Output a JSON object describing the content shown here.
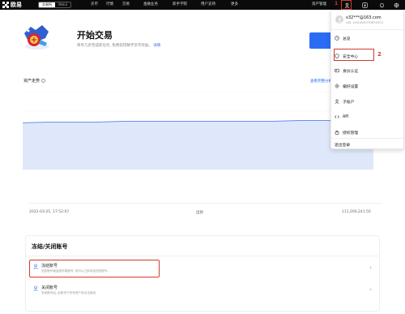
{
  "topbar": {
    "logo_text": "欧易",
    "segments": [
      {
        "label": "交易所",
        "active": true
      },
      {
        "label": "Web3",
        "active": false
      }
    ],
    "nav": [
      "买币",
      "行情",
      "交易",
      "金融业务",
      "新手学院",
      "用户支持",
      "更多"
    ],
    "asset_manage": "资产管理",
    "step1": "1"
  },
  "banner": {
    "title": "开始交易",
    "subtitle": "简单几步完成新任务, 免费获得数字货币奖励。",
    "details_link": "详情"
  },
  "assets": {
    "title": "资产走势",
    "link": "查看完整分析"
  },
  "chart_data": {
    "type": "area",
    "x": [
      "",
      "",
      "",
      "",
      "",
      "",
      "",
      "",
      "",
      "",
      "",
      "",
      "",
      "",
      ""
    ],
    "values": [
      60,
      61,
      61,
      61,
      62,
      62,
      62,
      62,
      62,
      62,
      62,
      63,
      63,
      63,
      63
    ],
    "ylim": [
      0,
      100
    ],
    "grid": true,
    "line_color": "#6b8ff0",
    "fill_color": "#dfe7fb"
  },
  "record": {
    "time": "2022-03-25, 17:52:07",
    "type": "出款",
    "amount": "111,200,241.50"
  },
  "freeze": {
    "title": "冻结/关闭账号",
    "rows": [
      {
        "name": "冻结账号",
        "desc": "如您账号被盗或怀疑账号, 您可以立即冻结您的账号。"
      },
      {
        "name": "关闭账号",
        "desc": "关闭账号后, 此账号下所有资产将无法使用"
      }
    ]
  },
  "dropdown": {
    "email": "x32***@163.com",
    "uid": "UID: 1451000070385109 4",
    "items": [
      {
        "label": "总览",
        "icon": "overview-icon"
      },
      {
        "label": "安全中心",
        "icon": "security-icon"
      },
      {
        "label": "身份认证",
        "icon": "identity-icon"
      },
      {
        "label": "偏好设置",
        "icon": "preferences-icon"
      },
      {
        "label": "子账户",
        "icon": "sub-account-icon"
      },
      {
        "label": "API",
        "icon": "api-icon"
      },
      {
        "label": "授权管理",
        "icon": "authorization-icon"
      }
    ],
    "logout": "退出登录",
    "step2": "2"
  },
  "colors": {
    "brand_blue": "#2a6df4",
    "annotation_red": "#d43a2f",
    "nav_bg": "#0b0b0b"
  }
}
